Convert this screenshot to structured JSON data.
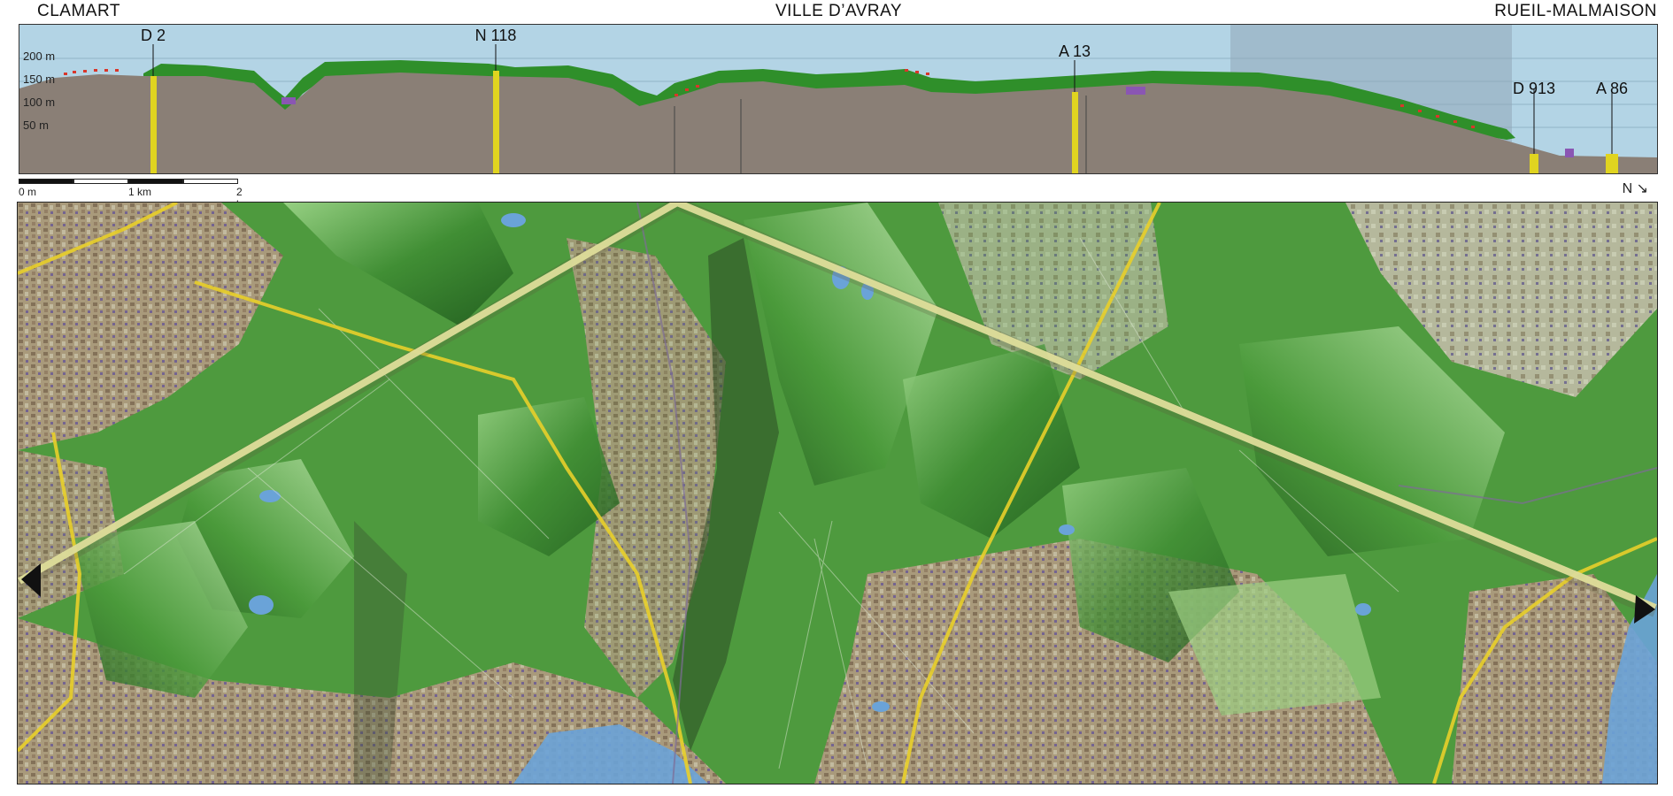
{
  "towns": {
    "left": "CLAMART",
    "center": "VILLE D’AVRAY",
    "right": "RUEIL-MALMAISON"
  },
  "roads": [
    {
      "label": "D 2"
    },
    {
      "label": "N 118"
    },
    {
      "label": "A 13"
    },
    {
      "label": "D 913"
    },
    {
      "label": "A 86"
    }
  ],
  "elevation_labels": [
    "200 m",
    "150 m",
    "100 m",
    "50 m"
  ],
  "scale": {
    "ticks": [
      "0 m",
      "1 km",
      "2 km"
    ]
  },
  "north": {
    "label": "N",
    "icon": "arrow-south-east-icon"
  },
  "colors": {
    "sky": "#b3d4e5",
    "terrain": "#8a7f76",
    "forest": "#2f8f2a",
    "road_marker": "#e0d420",
    "profile_line": "#dedd9a",
    "water": "#6aa3d8"
  }
}
